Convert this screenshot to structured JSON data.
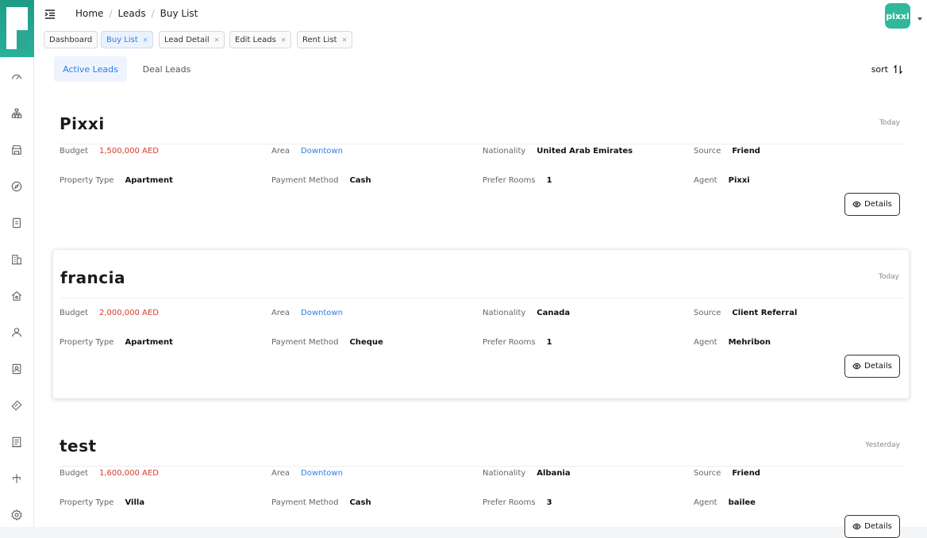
{
  "breadcrumb": {
    "home": "Home",
    "leads": "Leads",
    "current": "Buy List"
  },
  "avatar_text": "pixxi",
  "open_tabs": [
    {
      "label": "Dashboard",
      "closable": false
    },
    {
      "label": "Buy List",
      "closable": true,
      "active": true
    },
    {
      "label": "Lead Detail",
      "closable": true
    },
    {
      "label": "Edit Leads",
      "closable": true
    },
    {
      "label": "Rent List",
      "closable": true
    }
  ],
  "lead_tabs": {
    "active": "Active Leads",
    "other": "Deal Leads"
  },
  "sort_label": "sort",
  "field_labels": {
    "budget": "Budget",
    "area": "Area",
    "nationality": "Nationality",
    "source": "Source",
    "property_type": "Property Type",
    "payment_method": "Payment Method",
    "prefer_rooms": "Prefer Rooms",
    "agent": "Agent"
  },
  "details_label": "Details",
  "leads": [
    {
      "name": "Pixxi",
      "date": "Today",
      "budget": "1,500,000 AED",
      "area": "Downtown",
      "nationality": "United Arab Emirates",
      "source": "Friend",
      "property_type": "Apartment",
      "payment_method": "Cash",
      "prefer_rooms": "1",
      "agent": "Pixxi"
    },
    {
      "name": "francia",
      "date": "Today",
      "budget": "2,000,000 AED",
      "area": "Downtown",
      "nationality": "Canada",
      "source": "Client Referral",
      "property_type": "Apartment",
      "payment_method": "Cheque",
      "prefer_rooms": "1",
      "agent": "Mehribon"
    },
    {
      "name": "test",
      "date": "Yesterday",
      "budget": "1,600,000 AED",
      "area": "Downtown",
      "nationality": "Albania",
      "source": "Friend",
      "property_type": "Villa",
      "payment_method": "Cash",
      "prefer_rooms": "3",
      "agent": "bailee"
    }
  ],
  "sidebar_icons": [
    "dashboard-icon",
    "org-icon",
    "store-icon",
    "compass-icon",
    "document-icon",
    "building-icon",
    "home-icon",
    "user-icon",
    "contact-icon",
    "tag-icon",
    "report-icon",
    "split-icon",
    "settings-icon"
  ],
  "colors": {
    "brand": "#2aa893",
    "accent_blue": "#2b7de9",
    "budget_red": "#d63a2a"
  }
}
